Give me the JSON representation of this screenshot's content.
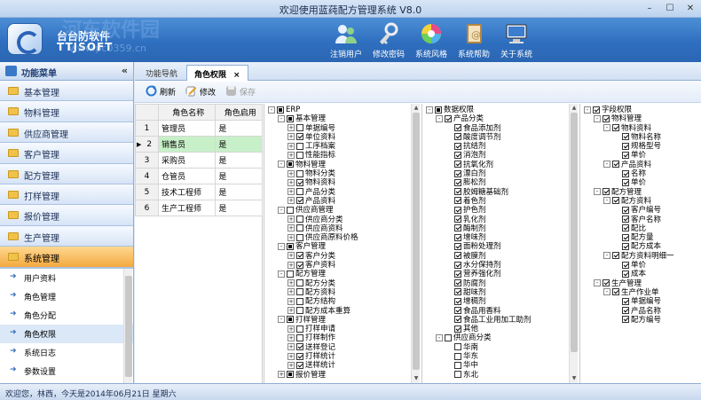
{
  "window": {
    "title": "欢迎使用蓝莼配方管理系统 V8.0",
    "min": "–",
    "max": "☐",
    "close": "✕"
  },
  "logo": {
    "cn": "台台防软件",
    "en": "TTJSOFT",
    "watermark": "河东软件园",
    "watermark_url": "www.pc0359.cn"
  },
  "header_buttons": [
    {
      "label": "注销用户",
      "icon": "users-icon"
    },
    {
      "label": "修改密码",
      "icon": "key-icon"
    },
    {
      "label": "系统风格",
      "icon": "color-wheel-icon"
    },
    {
      "label": "系统帮助",
      "icon": "help-book-icon"
    },
    {
      "label": "关于系统",
      "icon": "computer-icon"
    }
  ],
  "sidebar": {
    "title": "功能菜单",
    "collapse": "«",
    "categories": [
      "基本管理",
      "物料管理",
      "供应商管理",
      "客户管理",
      "配方管理",
      "打样管理",
      "报价管理",
      "生产管理",
      "系统管理"
    ],
    "active_category": "系统管理",
    "items": [
      "用户资料",
      "角色管理",
      "角色分配",
      "角色权限",
      "系统日志",
      "参数设置"
    ],
    "selected_item": "角色权限"
  },
  "tabs": [
    {
      "label": "功能导航"
    },
    {
      "label": "角色权限",
      "close": "×"
    }
  ],
  "toolbar": {
    "refresh": "刷新",
    "edit": "修改",
    "save": "保存"
  },
  "grid": {
    "columns": [
      "角色名称",
      "角色启用"
    ],
    "rows": [
      {
        "n": "1",
        "name": "管理员",
        "enabled": "是"
      },
      {
        "n": "2",
        "name": "销售员",
        "enabled": "是"
      },
      {
        "n": "3",
        "name": "采购员",
        "enabled": "是"
      },
      {
        "n": "4",
        "name": "仓管员",
        "enabled": "是"
      },
      {
        "n": "5",
        "name": "技术工程师",
        "enabled": "是"
      },
      {
        "n": "6",
        "name": "生产工程师",
        "enabled": "是"
      }
    ],
    "selected_row": "2",
    "row_marker": "▶"
  },
  "tree_function": [
    {
      "t": "ERP",
      "l": 0,
      "e": "-",
      "c": "part"
    },
    {
      "t": "基本管理",
      "l": 1,
      "e": "-",
      "c": "part"
    },
    {
      "t": "单据编号",
      "l": 2,
      "e": "+",
      "c": ""
    },
    {
      "t": "单位资料",
      "l": 2,
      "e": "+",
      "c": "on"
    },
    {
      "t": "工序档案",
      "l": 2,
      "e": "+",
      "c": ""
    },
    {
      "t": "性能指标",
      "l": 2,
      "e": "+",
      "c": ""
    },
    {
      "t": "物料管理",
      "l": 1,
      "e": "-",
      "c": "part"
    },
    {
      "t": "物料分类",
      "l": 2,
      "e": "+",
      "c": ""
    },
    {
      "t": "物料资料",
      "l": 2,
      "e": "+",
      "c": "on"
    },
    {
      "t": "产品分类",
      "l": 2,
      "e": "+",
      "c": ""
    },
    {
      "t": "产品资料",
      "l": 2,
      "e": "+",
      "c": "on"
    },
    {
      "t": "供应商管理",
      "l": 1,
      "e": "-",
      "c": ""
    },
    {
      "t": "供应商分类",
      "l": 2,
      "e": "+",
      "c": ""
    },
    {
      "t": "供应商资料",
      "l": 2,
      "e": "+",
      "c": ""
    },
    {
      "t": "供应商原料价格",
      "l": 2,
      "e": "+",
      "c": ""
    },
    {
      "t": "客户管理",
      "l": 1,
      "e": "-",
      "c": "part"
    },
    {
      "t": "客户分类",
      "l": 2,
      "e": "+",
      "c": "on"
    },
    {
      "t": "客户资料",
      "l": 2,
      "e": "+",
      "c": "on"
    },
    {
      "t": "配方管理",
      "l": 1,
      "e": "-",
      "c": ""
    },
    {
      "t": "配方分类",
      "l": 2,
      "e": "+",
      "c": ""
    },
    {
      "t": "配方资料",
      "l": 2,
      "e": "+",
      "c": ""
    },
    {
      "t": "配方结构",
      "l": 2,
      "e": "+",
      "c": ""
    },
    {
      "t": "配方成本重算",
      "l": 2,
      "e": "+",
      "c": ""
    },
    {
      "t": "打样管理",
      "l": 1,
      "e": "-",
      "c": "part"
    },
    {
      "t": "打样申请",
      "l": 2,
      "e": "+",
      "c": ""
    },
    {
      "t": "打样制作",
      "l": 2,
      "e": "+",
      "c": ""
    },
    {
      "t": "送样登记",
      "l": 2,
      "e": "+",
      "c": "on"
    },
    {
      "t": "打样统计",
      "l": 2,
      "e": "+",
      "c": "on"
    },
    {
      "t": "送样统计",
      "l": 2,
      "e": "+",
      "c": "on"
    },
    {
      "t": "报价管理",
      "l": 1,
      "e": "+",
      "c": "part"
    }
  ],
  "tree_data": [
    {
      "t": "数据权限",
      "l": 0,
      "e": "-",
      "c": "part"
    },
    {
      "t": "产品分类",
      "l": 1,
      "e": "-",
      "c": "on"
    },
    {
      "t": "食品添加剂",
      "l": 2,
      "e": "",
      "c": "on"
    },
    {
      "t": "酸度调节剂",
      "l": 2,
      "e": "",
      "c": "on"
    },
    {
      "t": "抗结剂",
      "l": 2,
      "e": "",
      "c": "on"
    },
    {
      "t": "消泡剂",
      "l": 2,
      "e": "",
      "c": "on"
    },
    {
      "t": "抗氧化剂",
      "l": 2,
      "e": "",
      "c": "on"
    },
    {
      "t": "漂白剂",
      "l": 2,
      "e": "",
      "c": "on"
    },
    {
      "t": "膨松剂",
      "l": 2,
      "e": "",
      "c": "on"
    },
    {
      "t": "胶姆糖基础剂",
      "l": 2,
      "e": "",
      "c": "on"
    },
    {
      "t": "着色剂",
      "l": 2,
      "e": "",
      "c": "on"
    },
    {
      "t": "护色剂",
      "l": 2,
      "e": "",
      "c": "on"
    },
    {
      "t": "乳化剂",
      "l": 2,
      "e": "",
      "c": "on"
    },
    {
      "t": "酶制剂",
      "l": 2,
      "e": "",
      "c": "on"
    },
    {
      "t": "增味剂",
      "l": 2,
      "e": "",
      "c": "on"
    },
    {
      "t": "面粉处理剂",
      "l": 2,
      "e": "",
      "c": "on"
    },
    {
      "t": "被膜剂",
      "l": 2,
      "e": "",
      "c": "on"
    },
    {
      "t": "水分保持剂",
      "l": 2,
      "e": "",
      "c": "on"
    },
    {
      "t": "营养强化剂",
      "l": 2,
      "e": "",
      "c": "on"
    },
    {
      "t": "防腐剂",
      "l": 2,
      "e": "",
      "c": "on"
    },
    {
      "t": "甜味剂",
      "l": 2,
      "e": "",
      "c": "on"
    },
    {
      "t": "增稠剂",
      "l": 2,
      "e": "",
      "c": "on"
    },
    {
      "t": "食品用香料",
      "l": 2,
      "e": "",
      "c": "on"
    },
    {
      "t": "食品工业用加工助剂",
      "l": 2,
      "e": "",
      "c": "on"
    },
    {
      "t": "其他",
      "l": 2,
      "e": "",
      "c": "on"
    },
    {
      "t": "供应商分类",
      "l": 1,
      "e": "-",
      "c": ""
    },
    {
      "t": "华南",
      "l": 2,
      "e": "",
      "c": ""
    },
    {
      "t": "华东",
      "l": 2,
      "e": "",
      "c": ""
    },
    {
      "t": "华中",
      "l": 2,
      "e": "",
      "c": ""
    },
    {
      "t": "东北",
      "l": 2,
      "e": "",
      "c": ""
    }
  ],
  "tree_field": [
    {
      "t": "字段权限",
      "l": 0,
      "e": "-",
      "c": "on"
    },
    {
      "t": "物料管理",
      "l": 1,
      "e": "-",
      "c": "on"
    },
    {
      "t": "物料资料",
      "l": 2,
      "e": "-",
      "c": "on"
    },
    {
      "t": "物料名称",
      "l": 3,
      "e": "",
      "c": "on"
    },
    {
      "t": "规格型号",
      "l": 3,
      "e": "",
      "c": "on"
    },
    {
      "t": "单价",
      "l": 3,
      "e": "",
      "c": "on"
    },
    {
      "t": "产品资料",
      "l": 2,
      "e": "-",
      "c": "on"
    },
    {
      "t": "名称",
      "l": 3,
      "e": "",
      "c": "on"
    },
    {
      "t": "单价",
      "l": 3,
      "e": "",
      "c": "on"
    },
    {
      "t": "配方管理",
      "l": 1,
      "e": "-",
      "c": "on"
    },
    {
      "t": "配方资料",
      "l": 2,
      "e": "-",
      "c": "on"
    },
    {
      "t": "客户编号",
      "l": 3,
      "e": "",
      "c": "on"
    },
    {
      "t": "客户名称",
      "l": 3,
      "e": "",
      "c": "on"
    },
    {
      "t": "配比",
      "l": 3,
      "e": "",
      "c": "on"
    },
    {
      "t": "配方量",
      "l": 3,
      "e": "",
      "c": "on"
    },
    {
      "t": "配方成本",
      "l": 3,
      "e": "",
      "c": "on"
    },
    {
      "t": "配方资料明细一",
      "l": 2,
      "e": "-",
      "c": "on"
    },
    {
      "t": "单价",
      "l": 3,
      "e": "",
      "c": "on"
    },
    {
      "t": "成本",
      "l": 3,
      "e": "",
      "c": "on"
    },
    {
      "t": "生产管理",
      "l": 1,
      "e": "-",
      "c": "on"
    },
    {
      "t": "生产作业单",
      "l": 2,
      "e": "-",
      "c": "on"
    },
    {
      "t": "单据编号",
      "l": 3,
      "e": "",
      "c": "on"
    },
    {
      "t": "产品名称",
      "l": 3,
      "e": "",
      "c": "on"
    },
    {
      "t": "配方编号",
      "l": 3,
      "e": "",
      "c": "on"
    }
  ],
  "status": "欢迎您，林西，今天是2014年06月21日 星期六",
  "colors": {
    "header": "#2f6fbf",
    "active_category": "#f3a93f",
    "selected_row": "#c8f0c8"
  }
}
